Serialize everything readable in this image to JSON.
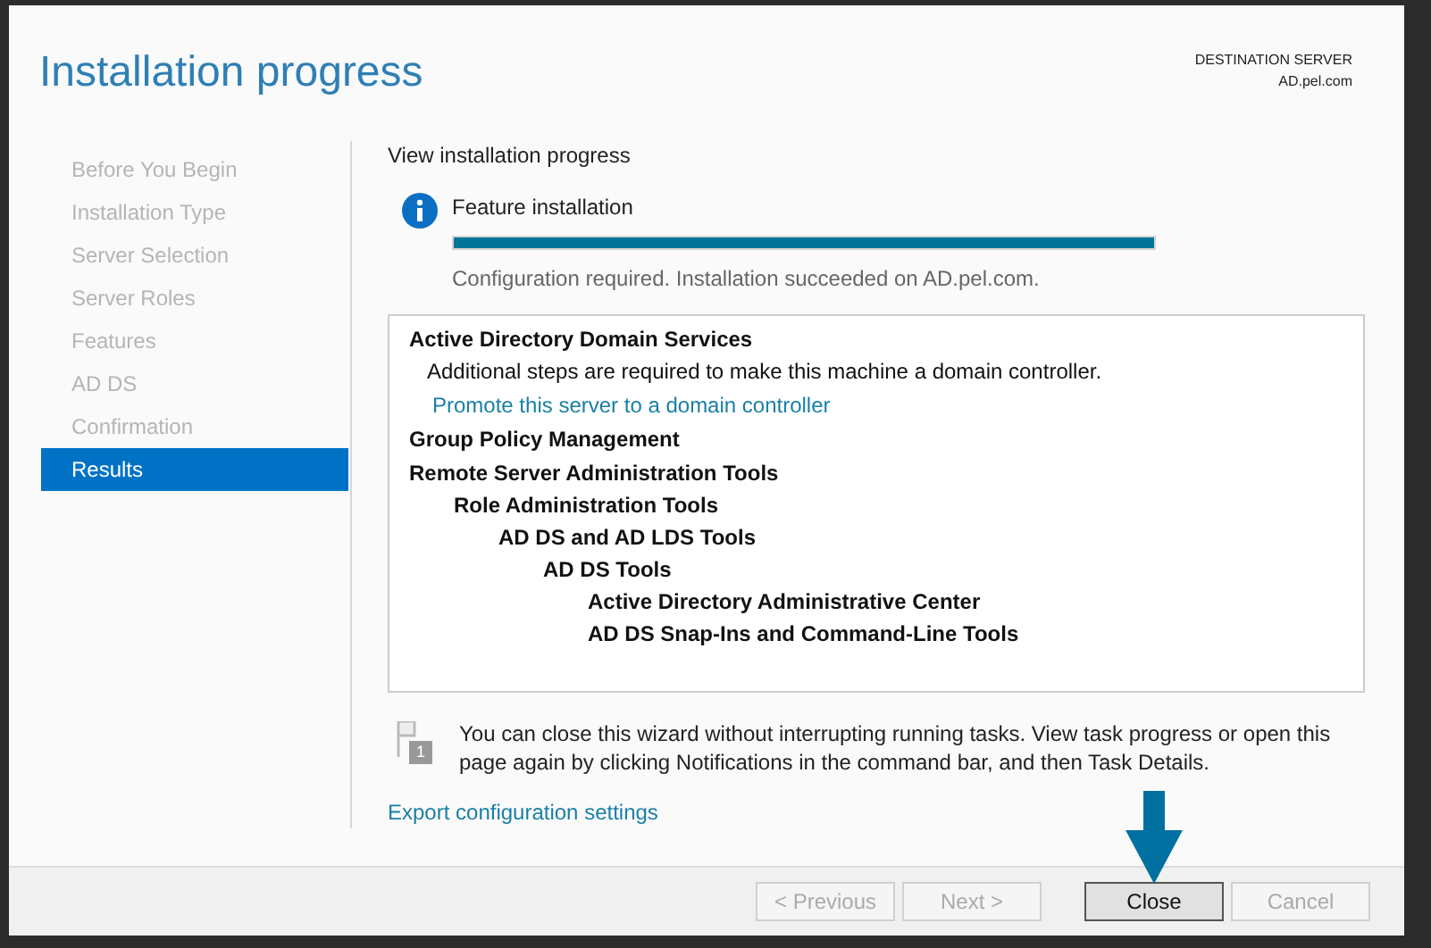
{
  "window": {
    "title": "Installation progress"
  },
  "destination": {
    "label": "DESTINATION SERVER",
    "server": "AD.pel.com"
  },
  "sidebar": {
    "items": [
      {
        "label": "Before You Begin",
        "selected": false
      },
      {
        "label": "Installation Type",
        "selected": false
      },
      {
        "label": "Server Selection",
        "selected": false
      },
      {
        "label": "Server Roles",
        "selected": false
      },
      {
        "label": "Features",
        "selected": false
      },
      {
        "label": "AD DS",
        "selected": false
      },
      {
        "label": "Confirmation",
        "selected": false
      },
      {
        "label": "Results",
        "selected": true
      }
    ]
  },
  "content": {
    "heading": "View installation progress",
    "feature": {
      "title": "Feature installation",
      "level": 1,
      "status": "Configuration required. Installation succeeded on AD.pel.com."
    },
    "results": [
      {
        "kind": "heading",
        "text": "Active Directory Domain Services",
        "children": [
          {
            "kind": "text",
            "text": "Additional steps are required to make this machine a domain controller."
          },
          {
            "kind": "link",
            "text": "Promote this server to a domain controller"
          }
        ]
      },
      {
        "kind": "heading",
        "text": "Group Policy Management"
      },
      {
        "kind": "heading",
        "text": "Remote Server Administration Tools",
        "children": [
          {
            "kind": "heading",
            "text": "Role Administration Tools",
            "children": [
              {
                "kind": "heading",
                "text": "AD DS and AD LDS Tools",
                "children": [
                  {
                    "kind": "heading",
                    "text": "AD DS Tools",
                    "children": [
                      {
                        "kind": "heading",
                        "text": "Active Directory Administrative Center"
                      },
                      {
                        "kind": "heading",
                        "text": "AD DS Snap-Ins and Command-Line Tools"
                      }
                    ]
                  }
                ]
              }
            ]
          }
        ]
      }
    ],
    "note": {
      "badge": "1",
      "text": "You can close this wizard without interrupting running tasks. View task progress or open this page again by clicking Notifications in the command bar, and then Task Details."
    },
    "export_link": "Export configuration settings"
  },
  "buttons": [
    {
      "label": "< Previous",
      "disabled": true,
      "default": false
    },
    {
      "label": "Next >",
      "disabled": true,
      "default": false
    },
    {
      "label": "Close",
      "disabled": false,
      "default": true
    },
    {
      "label": "Cancel",
      "disabled": true,
      "default": false
    }
  ]
}
